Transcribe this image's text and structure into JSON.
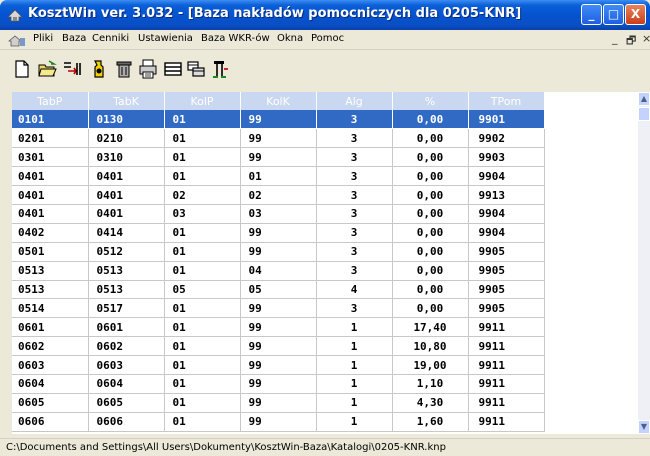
{
  "window": {
    "title": "KosztWin ver. 3.032 - [Baza nakładów pomocniczych dla 0205-KNR]",
    "minimize": "_",
    "maximize": "□",
    "close": "X"
  },
  "menu": {
    "items": [
      "Pliki",
      "Baza",
      "Cenniki",
      "Ustawienia",
      "Baza WKR-ów",
      "Okna",
      "Pomoc"
    ],
    "mdi_minimize": "_",
    "mdi_restore": "🗗",
    "mdi_close": "×"
  },
  "toolbar": {
    "icons": [
      "new-document-icon",
      "open-folder-icon",
      "insert-icon",
      "find-icon",
      "delete-icon",
      "print-icon",
      "view-icon",
      "copy-icon",
      "structure-icon"
    ]
  },
  "grid": {
    "columns": [
      "TabP",
      "TabK",
      "KolP",
      "KolK",
      "Alg",
      "%",
      "TPom"
    ],
    "rows": [
      [
        "0101",
        "0130",
        "01",
        "99",
        "3",
        "0,00",
        "9901"
      ],
      [
        "0201",
        "0210",
        "01",
        "99",
        "3",
        "0,00",
        "9902"
      ],
      [
        "0301",
        "0310",
        "01",
        "99",
        "3",
        "0,00",
        "9903"
      ],
      [
        "0401",
        "0401",
        "01",
        "01",
        "3",
        "0,00",
        "9904"
      ],
      [
        "0401",
        "0401",
        "02",
        "02",
        "3",
        "0,00",
        "9913"
      ],
      [
        "0401",
        "0401",
        "03",
        "03",
        "3",
        "0,00",
        "9904"
      ],
      [
        "0402",
        "0414",
        "01",
        "99",
        "3",
        "0,00",
        "9904"
      ],
      [
        "0501",
        "0512",
        "01",
        "99",
        "3",
        "0,00",
        "9905"
      ],
      [
        "0513",
        "0513",
        "01",
        "04",
        "3",
        "0,00",
        "9905"
      ],
      [
        "0513",
        "0513",
        "05",
        "05",
        "4",
        "0,00",
        "9905"
      ],
      [
        "0514",
        "0517",
        "01",
        "99",
        "3",
        "0,00",
        "9905"
      ],
      [
        "0601",
        "0601",
        "01",
        "99",
        "1",
        "17,40",
        "9911"
      ],
      [
        "0602",
        "0602",
        "01",
        "99",
        "1",
        "10,80",
        "9911"
      ],
      [
        "0603",
        "0603",
        "01",
        "99",
        "1",
        "19,00",
        "9911"
      ],
      [
        "0604",
        "0604",
        "01",
        "99",
        "1",
        "1,10",
        "9911"
      ],
      [
        "0605",
        "0605",
        "01",
        "99",
        "1",
        "4,30",
        "9911"
      ],
      [
        "0606",
        "0606",
        "01",
        "99",
        "1",
        "1,60",
        "9911"
      ]
    ],
    "selected_row": 0
  },
  "status": {
    "path": "C:\\Documents and Settings\\All Users\\Dokumenty\\KosztWin-Baza\\Katalogi\\0205-KNR.knp"
  }
}
